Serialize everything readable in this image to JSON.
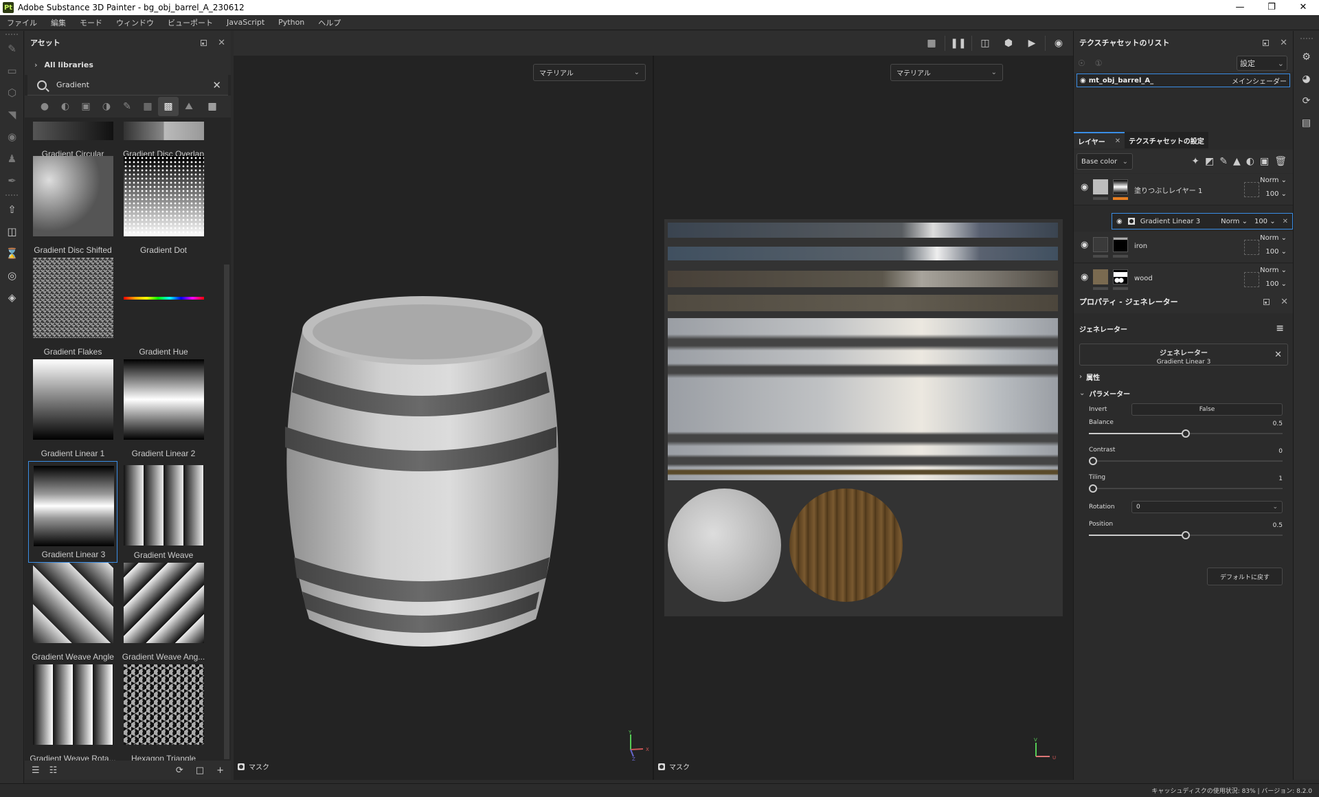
{
  "window": {
    "title": "Adobe Substance 3D Painter - bg_obj_barrel_A_230612",
    "logo": "Pt",
    "controls": [
      "minimize-icon",
      "restore-icon",
      "close-icon"
    ]
  },
  "menu": [
    "ファイル",
    "編集",
    "モード",
    "ウィンドウ",
    "ビューポート",
    "JavaScript",
    "Python",
    "ヘルプ"
  ],
  "left_toolbar": {
    "tools": [
      "brush-icon",
      "eraser-icon",
      "projection-icon",
      "polygon-fill-icon",
      "smudge-icon",
      "clone-icon",
      "color-picker-icon",
      "export-icon",
      "bake-icon",
      "history-icon",
      "assets-icon",
      "texture-set-icon"
    ]
  },
  "assets": {
    "title": "アセット",
    "libraries_label": "All libraries",
    "search_value": "Gradient",
    "filters": [
      "material-icon",
      "smart-material-icon",
      "mask-icon",
      "smart-mask-icon",
      "brush-icon",
      "alpha-icon",
      "procedural-icon",
      "environment-icon"
    ],
    "active_filter": "procedural-icon",
    "items": [
      {
        "name": "Gradient Circular"
      },
      {
        "name": "Gradient Disc Overlap"
      },
      {
        "name": "Gradient Disc Shifted"
      },
      {
        "name": "Gradient Dot"
      },
      {
        "name": "Gradient Flakes"
      },
      {
        "name": "Gradient Hue"
      },
      {
        "name": "Gradient Linear 1"
      },
      {
        "name": "Gradient Linear 2"
      },
      {
        "name": "Gradient Linear 3",
        "selected": true
      },
      {
        "name": "Gradient Weave"
      },
      {
        "name": "Gradient Weave Angle"
      },
      {
        "name": "Gradient Weave Ang..."
      },
      {
        "name": "Gradient Weave Rota..."
      },
      {
        "name": "Hexagon Triangle"
      }
    ]
  },
  "viewport": {
    "toolbar": [
      "hide-icon",
      "pause-icon",
      "split-view-icon",
      "display-icon",
      "camera-icon",
      "screenshot-icon"
    ],
    "left": {
      "mode": "マテリアル",
      "mask_label": "マスク",
      "axes": [
        "Y",
        "X",
        "Z"
      ]
    },
    "right": {
      "mode": "マテリアル",
      "mask_label": "マスク",
      "axes": [
        "V",
        "U"
      ]
    }
  },
  "texture_sets": {
    "title": "テクスチャセットのリスト",
    "settings_label": "設定",
    "items": [
      {
        "name": "mt_obj_barrel_A_",
        "shader": "メインシェーダー"
      }
    ]
  },
  "layers": {
    "tabs": [
      "レイヤー",
      "テクスチャセットの設定"
    ],
    "channel": "Base color",
    "list": [
      {
        "name": "塗りつぶしレイヤー 1",
        "blend": "Norm",
        "opacity": "100"
      },
      {
        "name": "iron",
        "blend": "Norm",
        "opacity": "100"
      },
      {
        "name": "wood",
        "blend": "Norm",
        "opacity": "100"
      }
    ],
    "effect": {
      "name": "Gradient Linear 3",
      "blend": "Norm",
      "opacity": "100"
    }
  },
  "properties": {
    "title": "プロパティ - ジェネレーター",
    "section": "ジェネレーター",
    "generator_label": "ジェネレーター",
    "generator_name": "Gradient Linear 3",
    "attributes_label": "属性",
    "parameters_label": "パラメーター",
    "params": {
      "invert": {
        "label": "Invert",
        "value": "False"
      },
      "balance": {
        "label": "Balance",
        "value": "0.5",
        "fraction": 0.5
      },
      "contrast": {
        "label": "Contrast",
        "value": "0",
        "fraction": 0
      },
      "tiling": {
        "label": "Tiling",
        "value": "1",
        "fraction": 0
      },
      "rotation": {
        "label": "Rotation",
        "value": "0"
      },
      "position": {
        "label": "Position",
        "value": "0.5",
        "fraction": 0.5
      }
    },
    "reset_label": "デフォルトに戻す"
  },
  "right_toolbar": [
    "display-settings-icon",
    "shader-settings-icon",
    "history-icon",
    "log-icon"
  ],
  "status": {
    "text": "キャッシュディスクの使用状況: 83% | バージョン: 8.2.0"
  }
}
